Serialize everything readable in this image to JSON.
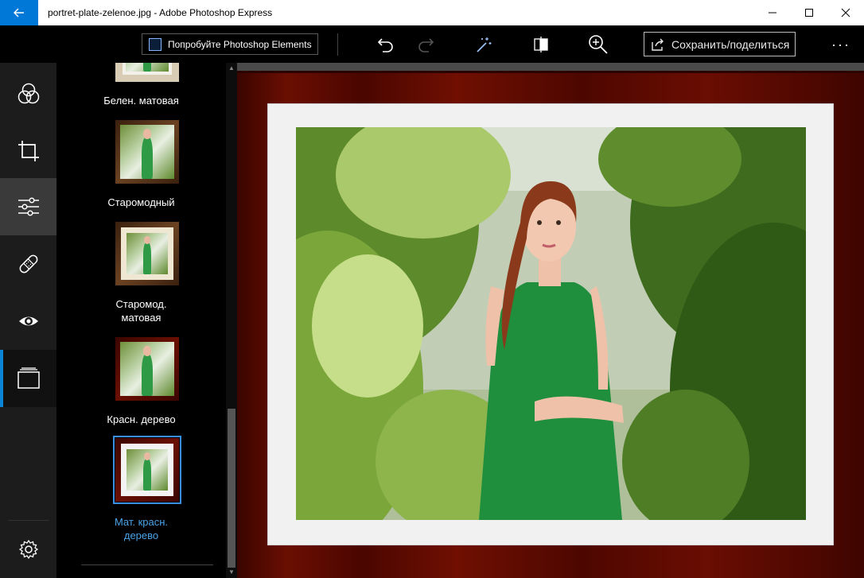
{
  "window": {
    "title": "portret-plate-zelenoe.jpg - Adobe Photoshop Express",
    "controls": [
      "minimize-icon",
      "maximize-icon",
      "close-icon"
    ]
  },
  "toolbar": {
    "try_label": "Попробуйте Photoshop Elements",
    "save_label": "Сохранить/поделиться",
    "more_label": "···",
    "icons": [
      "undo-icon",
      "redo-icon",
      "magic-wand-icon",
      "compare-icon",
      "zoom-icon"
    ]
  },
  "rail": {
    "items": [
      "looks-icon",
      "crop-icon",
      "adjustments-icon",
      "heal-icon",
      "red-eye-icon",
      "frames-icon",
      "settings-icon"
    ],
    "active": "frames-icon"
  },
  "frames": {
    "items": [
      {
        "label": "Белен. матовая",
        "style": "whitewash"
      },
      {
        "label": "Старомодный",
        "style": "oldfashioned"
      },
      {
        "label": "Старомод.\nматовая",
        "style": "oldfashioned-matte"
      },
      {
        "label": "Красн. дерево",
        "style": "redwood"
      },
      {
        "label": "Мат. красн.\nдерево",
        "style": "redwood-matte",
        "selected": true
      }
    ]
  },
  "colors": {
    "accent": "#0078d7",
    "selected_label": "#4aa3e8",
    "redwood": "#5a0a02"
  }
}
